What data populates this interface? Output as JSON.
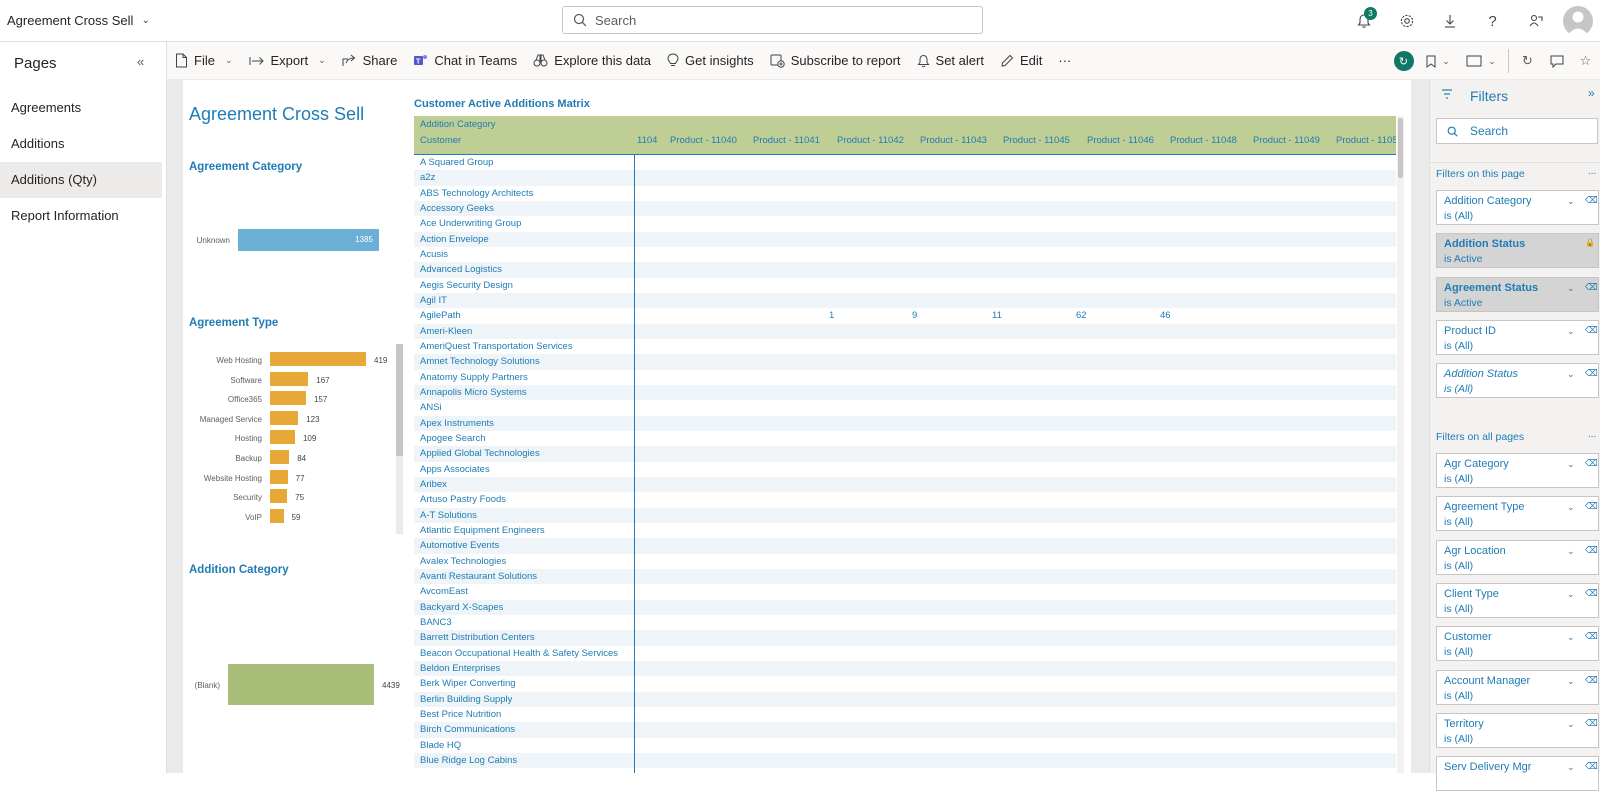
{
  "app": {
    "title": "Agreement Cross Sell",
    "search_placeholder": "Search",
    "notifications_count": "3"
  },
  "pages_pane": {
    "heading": "Pages",
    "items": [
      {
        "label": "Agreements",
        "active": false
      },
      {
        "label": "Additions",
        "active": false
      },
      {
        "label": "Additions (Qty)",
        "active": true
      },
      {
        "label": "Report Information",
        "active": false
      }
    ]
  },
  "toolbar": {
    "file": "File",
    "export": "Export",
    "share": "Share",
    "chat_in_teams": "Chat in Teams",
    "explore": "Explore this data",
    "insights": "Get insights",
    "subscribe": "Subscribe to report",
    "alert": "Set alert",
    "edit": "Edit",
    "more": "···"
  },
  "report": {
    "title": "Agreement Cross Sell",
    "agreement_category": {
      "title": "Agreement Category",
      "bars": [
        {
          "label": "Unknown",
          "value": 1385
        }
      ],
      "color": "#6baed6"
    },
    "agreement_type": {
      "title": "Agreement Type",
      "bars": [
        {
          "label": "Web Hosting",
          "value": 419
        },
        {
          "label": "Software",
          "value": 167
        },
        {
          "label": "Office365",
          "value": 157
        },
        {
          "label": "Managed Service",
          "value": 123
        },
        {
          "label": "Hosting",
          "value": 109
        },
        {
          "label": "Backup",
          "value": 84
        },
        {
          "label": "Website Hosting",
          "value": 77
        },
        {
          "label": "Security",
          "value": 75
        },
        {
          "label": "VoIP",
          "value": 59
        }
      ],
      "color": "#e8a838"
    },
    "addition_category": {
      "title": "Addition Category",
      "bars": [
        {
          "label": "(Blank)",
          "value": 4439
        }
      ],
      "color": "#a9bf79"
    }
  },
  "matrix": {
    "title": "Customer Active Additions Matrix",
    "row_header_top": "Addition Category",
    "row_header": "Customer",
    "columns": [
      "1104",
      "Product - 11040",
      "Product - 11041",
      "Product - 11042",
      "Product - 11043",
      "Product - 11045",
      "Product - 11046",
      "Product - 11048",
      "Product - 11049",
      "Product - 1105"
    ],
    "rows": [
      {
        "customer": "A Squared Group",
        "values": []
      },
      {
        "customer": "a2z",
        "values": []
      },
      {
        "customer": "ABS Technology Architects",
        "values": []
      },
      {
        "customer": "Accessory Geeks",
        "values": []
      },
      {
        "customer": "Ace Underwriting Group",
        "values": []
      },
      {
        "customer": "Action Envelope",
        "values": []
      },
      {
        "customer": "Acusis",
        "values": []
      },
      {
        "customer": "Advanced Logistics",
        "values": []
      },
      {
        "customer": "Aegis Security Design",
        "values": []
      },
      {
        "customer": "Agil IT",
        "values": []
      },
      {
        "customer": "AgilePath",
        "values": [
          "",
          "1",
          "9",
          "11",
          "62",
          "46",
          "",
          "",
          "",
          ""
        ]
      },
      {
        "customer": "Ameri-Kleen",
        "values": []
      },
      {
        "customer": "AmeriQuest Transportation Services",
        "values": []
      },
      {
        "customer": "Amnet Technology Solutions",
        "values": []
      },
      {
        "customer": "Anatomy Supply Partners",
        "values": []
      },
      {
        "customer": "Annapolis Micro Systems",
        "values": []
      },
      {
        "customer": "ANSi",
        "values": []
      },
      {
        "customer": "Apex Instruments",
        "values": []
      },
      {
        "customer": "Apogee Search",
        "values": []
      },
      {
        "customer": "Applied Global Technologies",
        "values": []
      },
      {
        "customer": "Apps Associates",
        "values": []
      },
      {
        "customer": "Aribex",
        "values": []
      },
      {
        "customer": "Artuso Pastry Foods",
        "values": []
      },
      {
        "customer": "A-T Solutions",
        "values": []
      },
      {
        "customer": "Atlantic Equipment Engineers",
        "values": []
      },
      {
        "customer": "Automotive Events",
        "values": []
      },
      {
        "customer": "Avalex Technologies",
        "values": []
      },
      {
        "customer": "Avanti Restaurant Solutions",
        "values": []
      },
      {
        "customer": "AvcomEast",
        "values": []
      },
      {
        "customer": "Backyard X-Scapes",
        "values": []
      },
      {
        "customer": "BANC3",
        "values": []
      },
      {
        "customer": "Barrett Distribution Centers",
        "values": []
      },
      {
        "customer": "Beacon Occupational Health & Safety Services",
        "values": []
      },
      {
        "customer": "Beldon Enterprises",
        "values": []
      },
      {
        "customer": "Berk Wiper Converting",
        "values": []
      },
      {
        "customer": "Berlin Building Supply",
        "values": []
      },
      {
        "customer": "Best Price Nutrition",
        "values": []
      },
      {
        "customer": "Birch Communications",
        "values": []
      },
      {
        "customer": "Blade HQ",
        "values": []
      },
      {
        "customer": "Blue Ridge Log Cabins",
        "values": []
      }
    ]
  },
  "filters": {
    "title": "Filters",
    "search_placeholder": "Search",
    "on_this_page_label": "Filters on this page",
    "on_all_pages_label": "Filters on all pages",
    "more": "...",
    "on_this_page": [
      {
        "name": "Addition Category",
        "value": "is (All)",
        "active": false,
        "italic": false,
        "locked": false
      },
      {
        "name": "Addition Status",
        "value": "is Active",
        "active": true,
        "italic": false,
        "locked": true
      },
      {
        "name": "Agreement Status",
        "value": "is Active",
        "active": true,
        "italic": false,
        "locked": false
      },
      {
        "name": "Product ID",
        "value": "is (All)",
        "active": false,
        "italic": false,
        "locked": false
      },
      {
        "name": "Addition Status",
        "value": "is (All)",
        "active": false,
        "italic": true,
        "locked": false
      }
    ],
    "on_all_pages": [
      {
        "name": "Agr Category",
        "value": "is (All)"
      },
      {
        "name": "Agreement Type",
        "value": "is (All)"
      },
      {
        "name": "Agr Location",
        "value": "is (All)"
      },
      {
        "name": "Client Type",
        "value": "is (All)"
      },
      {
        "name": "Customer",
        "value": "is (All)"
      },
      {
        "name": "Account Manager",
        "value": "is (All)"
      },
      {
        "name": "Territory",
        "value": "is (All)"
      },
      {
        "name": "Serv Delivery Mgr",
        "value": ""
      }
    ]
  }
}
